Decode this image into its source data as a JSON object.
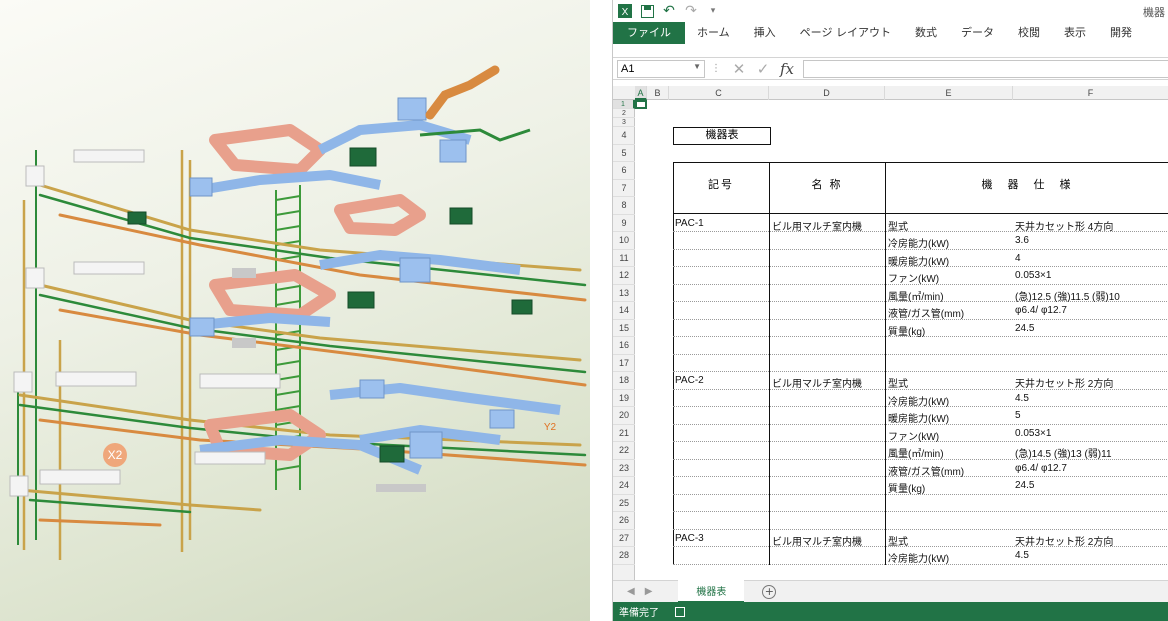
{
  "view3d": {
    "labels": {
      "grid_x": "X2",
      "grid_y": "Y2"
    }
  },
  "excel": {
    "title": "機器",
    "ribbon_tabs": [
      "ファイル",
      "ホーム",
      "挿入",
      "ページ レイアウト",
      "数式",
      "データ",
      "校閲",
      "表示",
      "開発"
    ],
    "name_box": "A1",
    "formula_value": "",
    "columns": [
      "A",
      "B",
      "C",
      "D",
      "E",
      "F"
    ],
    "rows": [
      "1",
      "2",
      "3",
      "4",
      "5",
      "6",
      "7",
      "8",
      "9",
      "10",
      "11",
      "12",
      "13",
      "14",
      "15",
      "16",
      "17",
      "18",
      "19",
      "20",
      "21",
      "22",
      "23",
      "24",
      "25",
      "26",
      "27",
      "28"
    ],
    "table_title": "機器表",
    "headers": {
      "symbol": "記号",
      "name": "名 称",
      "spec": "機　器　仕　様"
    },
    "equipment": [
      {
        "code": "PAC-1",
        "name": "ビル用マルチ室内機",
        "specs": [
          {
            "item": "型式",
            "value": "天井カセット形 4方向"
          },
          {
            "item": "冷房能力(kW)",
            "value": "3.6"
          },
          {
            "item": "暖房能力(kW)",
            "value": "4"
          },
          {
            "item": "ファン(kW)",
            "value": "0.053×1"
          },
          {
            "item": "風量(㎥/min)",
            "value": "(急)12.5 (強)11.5 (弱)10"
          },
          {
            "item": "液管/ガス管(mm)",
            "value": "φ6.4/ φ12.7"
          },
          {
            "item": "質量(kg)",
            "value": "24.5"
          }
        ]
      },
      {
        "code": "PAC-2",
        "name": "ビル用マルチ室内機",
        "specs": [
          {
            "item": "型式",
            "value": "天井カセット形 2方向"
          },
          {
            "item": "冷房能力(kW)",
            "value": "4.5"
          },
          {
            "item": "暖房能力(kW)",
            "value": "5"
          },
          {
            "item": "ファン(kW)",
            "value": "0.053×1"
          },
          {
            "item": "風量(㎥/min)",
            "value": "(急)14.5 (強)13 (弱)11"
          },
          {
            "item": "液管/ガス管(mm)",
            "value": "φ6.4/ φ12.7"
          },
          {
            "item": "質量(kg)",
            "value": "24.5"
          }
        ]
      },
      {
        "code": "PAC-3",
        "name": "ビル用マルチ室内機",
        "specs": [
          {
            "item": "型式",
            "value": "天井カセット形 2方向"
          },
          {
            "item": "冷房能力(kW)",
            "value": "4.5"
          }
        ]
      }
    ],
    "sheet_tab": "機器表",
    "status": "準備完了",
    "colors": {
      "accent": "#217346"
    }
  }
}
